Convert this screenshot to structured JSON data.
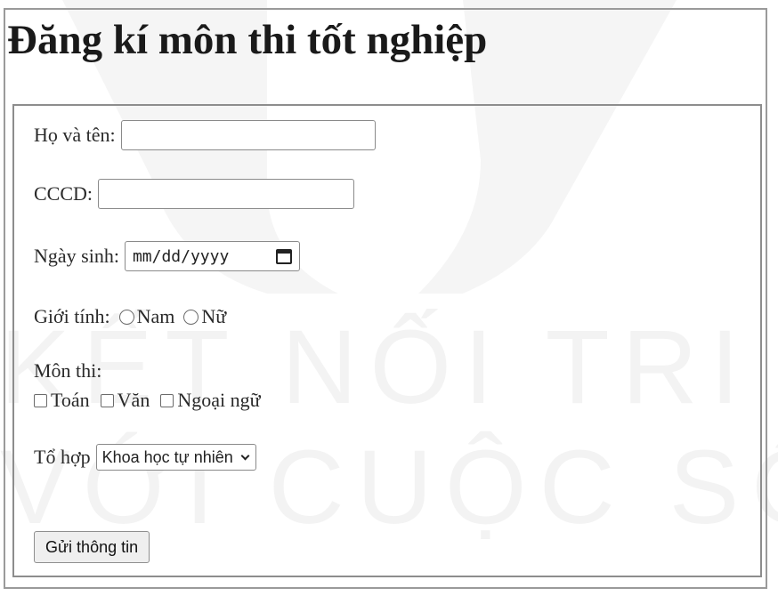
{
  "page": {
    "title": "Đăng kí  môn thi tốt nghiệp"
  },
  "watermark": {
    "line1": "KẾT NỐI TRI THỨC",
    "line2": "VỚI CUỘC SỐNG"
  },
  "form": {
    "name_label": "Họ và tên:",
    "name_value": "",
    "id_label": "CCCD:",
    "id_value": "",
    "dob_label": "Ngày sinh:",
    "dob_placeholder": "mm/dd/yyyy",
    "gender_label": "Giới tính:",
    "gender_options": [
      "Nam",
      "Nữ"
    ],
    "subjects_label": "Môn thi:",
    "subjects": [
      "Toán",
      "Văn",
      "Ngoại ngữ"
    ],
    "combo_label": "Tổ hợp",
    "combo_selected": "Khoa học tự nhiên",
    "submit_label": "Gửi thông tin"
  },
  "colors": {
    "border": "#8d8d8d",
    "button_bg": "#efefef"
  },
  "icons": {
    "date_picker": "calendar-icon",
    "select_arrow": "chevron-down-icon"
  }
}
